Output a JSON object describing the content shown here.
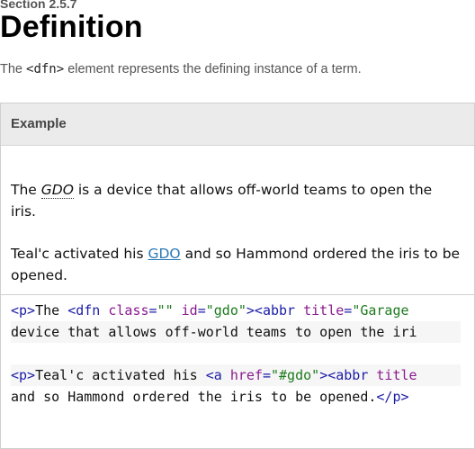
{
  "section": "Section 2.5.7",
  "title": "Definition",
  "intro": {
    "before": "The ",
    "code": "<dfn>",
    "after": " element represents the defining instance of a term."
  },
  "example": {
    "label": "Example",
    "para1": {
      "before": "The ",
      "term": "GDO",
      "after": " is a device that allows off-world teams to open the iris."
    },
    "para2": {
      "before": "Teal'c activated his ",
      "link": "GDO",
      "after": " and so Hammond ordered the iris to be opened."
    },
    "code": {
      "line1": {
        "t1": "<p>",
        "text1": "The ",
        "t2": "<dfn",
        "sp1": " ",
        "a1": "class",
        "eq1": "=",
        "v1": "\"\"",
        "sp2": " ",
        "a2": "id",
        "eq2": "=",
        "v2": "\"gdo\"",
        "t3": "><abbr",
        "sp3": " ",
        "a3": "title",
        "eq3": "=",
        "v3": "\"Garage"
      },
      "line2": "device that allows off-world teams to open the iri",
      "line4": {
        "t1": "<p>",
        "text1": "Teal'c activated his ",
        "t2": "<a",
        "sp1": " ",
        "a1": "href",
        "eq1": "=",
        "v1": "\"#gdo\"",
        "t3": "><abbr",
        "sp2": " ",
        "a2": "title"
      },
      "line5": {
        "text": "and so Hammond ordered the iris to be opened.",
        "t1": "</p>"
      }
    }
  }
}
